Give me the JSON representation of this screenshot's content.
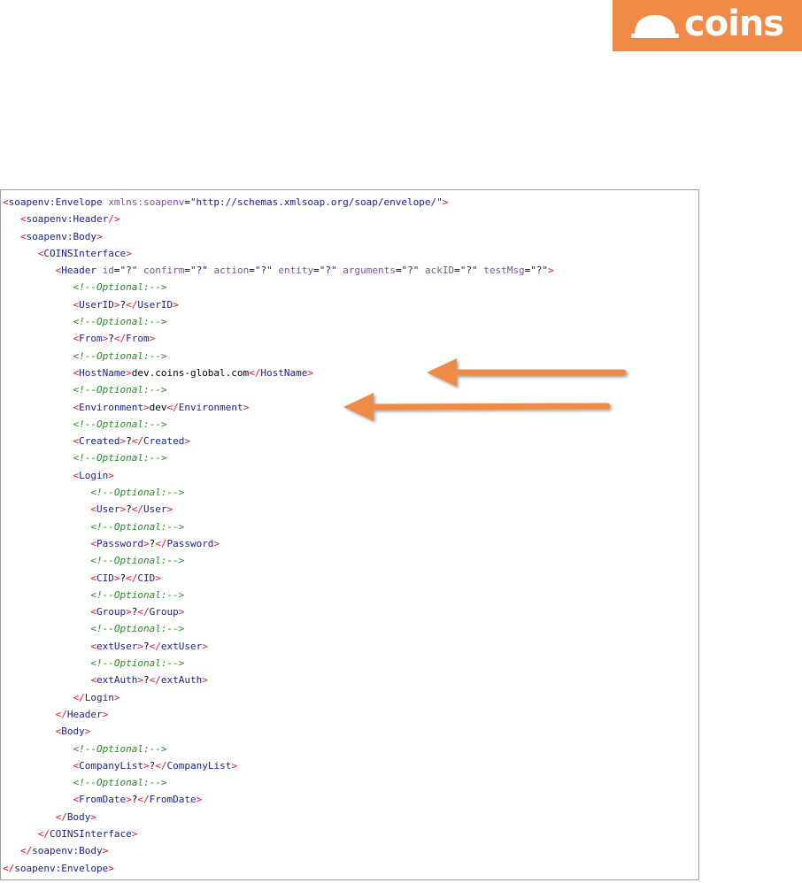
{
  "brand": {
    "logo_text": "coins",
    "logo_color": "#f08a47",
    "logo_icon": "hard-hat-icon"
  },
  "editor": {
    "highlighted_line": 13,
    "colors": {
      "bracket": "#e8162d",
      "tag": "#1a1f8c",
      "attribute": "#7c52a5",
      "value": "#1a1f8c",
      "comment": "#2a8a2a",
      "text": "#000000"
    },
    "lines": [
      {
        "indent": "",
        "tokens": [
          [
            "b",
            "<"
          ],
          [
            "n",
            "soapenv:Envelope"
          ],
          [
            "t",
            " "
          ],
          [
            "a",
            "xmlns:soapenv"
          ],
          [
            "t",
            "="
          ],
          [
            "v",
            "\"http://schemas.xmlsoap.org/soap/envelope/\""
          ],
          [
            "b",
            ">"
          ]
        ]
      },
      {
        "indent": "   ",
        "tokens": [
          [
            "b",
            "<"
          ],
          [
            "n",
            "soapenv:Header"
          ],
          [
            "b",
            "/>"
          ]
        ]
      },
      {
        "indent": "   ",
        "tokens": [
          [
            "b",
            "<"
          ],
          [
            "n",
            "soapenv:Body"
          ],
          [
            "b",
            ">"
          ]
        ]
      },
      {
        "indent": "      ",
        "tokens": [
          [
            "b",
            "<"
          ],
          [
            "n",
            "COINSInterface"
          ],
          [
            "b",
            ">"
          ]
        ]
      },
      {
        "indent": "         ",
        "tokens": [
          [
            "b",
            "<"
          ],
          [
            "n",
            "Header"
          ],
          [
            "t",
            " "
          ],
          [
            "a",
            "id"
          ],
          [
            "t",
            "="
          ],
          [
            "v",
            "\"?\""
          ],
          [
            "t",
            " "
          ],
          [
            "a",
            "confirm"
          ],
          [
            "t",
            "="
          ],
          [
            "v",
            "\"?\""
          ],
          [
            "t",
            " "
          ],
          [
            "a",
            "action"
          ],
          [
            "t",
            "="
          ],
          [
            "v",
            "\"?\""
          ],
          [
            "t",
            " "
          ],
          [
            "a",
            "entity"
          ],
          [
            "t",
            "="
          ],
          [
            "v",
            "\"?\""
          ],
          [
            "t",
            " "
          ],
          [
            "a",
            "arguments"
          ],
          [
            "t",
            "="
          ],
          [
            "v",
            "\"?\""
          ],
          [
            "t",
            " "
          ],
          [
            "a",
            "ackID"
          ],
          [
            "t",
            "="
          ],
          [
            "v",
            "\"?\""
          ],
          [
            "t",
            " "
          ],
          [
            "a",
            "testMsg"
          ],
          [
            "t",
            "="
          ],
          [
            "v",
            "\"?\""
          ],
          [
            "b",
            ">"
          ]
        ]
      },
      {
        "indent": "            ",
        "tokens": [
          [
            "c",
            "<!--Optional:-->"
          ]
        ]
      },
      {
        "indent": "            ",
        "tokens": [
          [
            "b",
            "<"
          ],
          [
            "n",
            "UserID"
          ],
          [
            "b",
            ">"
          ],
          [
            "t",
            "?"
          ],
          [
            "b",
            "</"
          ],
          [
            "n",
            "UserID"
          ],
          [
            "b",
            ">"
          ]
        ]
      },
      {
        "indent": "            ",
        "tokens": [
          [
            "c",
            "<!--Optional:-->"
          ]
        ]
      },
      {
        "indent": "            ",
        "tokens": [
          [
            "b",
            "<"
          ],
          [
            "n",
            "From"
          ],
          [
            "b",
            ">"
          ],
          [
            "t",
            "?"
          ],
          [
            "b",
            "</"
          ],
          [
            "n",
            "From"
          ],
          [
            "b",
            ">"
          ]
        ]
      },
      {
        "indent": "            ",
        "tokens": [
          [
            "c",
            "<!--Optional:-->"
          ]
        ]
      },
      {
        "indent": "            ",
        "tokens": [
          [
            "b",
            "<"
          ],
          [
            "n",
            "HostName"
          ],
          [
            "b",
            ">"
          ],
          [
            "t",
            "dev.coins-global.com"
          ],
          [
            "b",
            "</"
          ],
          [
            "n",
            "HostName"
          ],
          [
            "b",
            ">"
          ]
        ]
      },
      {
        "indent": "            ",
        "tokens": [
          [
            "c",
            "<!--Optional:-->"
          ]
        ]
      },
      {
        "indent": "            ",
        "tokens": [
          [
            "b",
            "<"
          ],
          [
            "n",
            "Environment"
          ],
          [
            "b",
            ">"
          ],
          [
            "t",
            "dev"
          ],
          [
            "b",
            "</"
          ],
          [
            "n",
            "Environment"
          ],
          [
            "b",
            ">"
          ]
        ]
      },
      {
        "indent": "            ",
        "tokens": [
          [
            "c",
            "<!--Optional:-->"
          ]
        ]
      },
      {
        "indent": "            ",
        "tokens": [
          [
            "b",
            "<"
          ],
          [
            "n",
            "Created"
          ],
          [
            "b",
            ">"
          ],
          [
            "t",
            "?"
          ],
          [
            "b",
            "</"
          ],
          [
            "n",
            "Created"
          ],
          [
            "b",
            ">"
          ]
        ]
      },
      {
        "indent": "            ",
        "tokens": [
          [
            "c",
            "<!--Optional:-->"
          ]
        ]
      },
      {
        "indent": "            ",
        "tokens": [
          [
            "b",
            "<"
          ],
          [
            "n",
            "Login"
          ],
          [
            "b",
            ">"
          ]
        ]
      },
      {
        "indent": "               ",
        "tokens": [
          [
            "c",
            "<!--Optional:-->"
          ]
        ]
      },
      {
        "indent": "               ",
        "tokens": [
          [
            "b",
            "<"
          ],
          [
            "n",
            "User"
          ],
          [
            "b",
            ">"
          ],
          [
            "t",
            "?"
          ],
          [
            "b",
            "</"
          ],
          [
            "n",
            "User"
          ],
          [
            "b",
            ">"
          ]
        ]
      },
      {
        "indent": "               ",
        "tokens": [
          [
            "c",
            "<!--Optional:-->"
          ]
        ]
      },
      {
        "indent": "               ",
        "tokens": [
          [
            "b",
            "<"
          ],
          [
            "n",
            "Password"
          ],
          [
            "b",
            ">"
          ],
          [
            "t",
            "?"
          ],
          [
            "b",
            "</"
          ],
          [
            "n",
            "Password"
          ],
          [
            "b",
            ">"
          ]
        ]
      },
      {
        "indent": "               ",
        "tokens": [
          [
            "c",
            "<!--Optional:-->"
          ]
        ]
      },
      {
        "indent": "               ",
        "tokens": [
          [
            "b",
            "<"
          ],
          [
            "n",
            "CID"
          ],
          [
            "b",
            ">"
          ],
          [
            "t",
            "?"
          ],
          [
            "b",
            "</"
          ],
          [
            "n",
            "CID"
          ],
          [
            "b",
            ">"
          ]
        ]
      },
      {
        "indent": "               ",
        "tokens": [
          [
            "c",
            "<!--Optional:-->"
          ]
        ]
      },
      {
        "indent": "               ",
        "tokens": [
          [
            "b",
            "<"
          ],
          [
            "n",
            "Group"
          ],
          [
            "b",
            ">"
          ],
          [
            "t",
            "?"
          ],
          [
            "b",
            "</"
          ],
          [
            "n",
            "Group"
          ],
          [
            "b",
            ">"
          ]
        ]
      },
      {
        "indent": "               ",
        "tokens": [
          [
            "c",
            "<!--Optional:-->"
          ]
        ]
      },
      {
        "indent": "               ",
        "tokens": [
          [
            "b",
            "<"
          ],
          [
            "n",
            "extUser"
          ],
          [
            "b",
            ">"
          ],
          [
            "t",
            "?"
          ],
          [
            "b",
            "</"
          ],
          [
            "n",
            "extUser"
          ],
          [
            "b",
            ">"
          ]
        ]
      },
      {
        "indent": "               ",
        "tokens": [
          [
            "c",
            "<!--Optional:-->"
          ]
        ]
      },
      {
        "indent": "               ",
        "tokens": [
          [
            "b",
            "<"
          ],
          [
            "n",
            "extAuth"
          ],
          [
            "b",
            ">"
          ],
          [
            "t",
            "?"
          ],
          [
            "b",
            "</"
          ],
          [
            "n",
            "extAuth"
          ],
          [
            "b",
            ">"
          ]
        ]
      },
      {
        "indent": "            ",
        "tokens": [
          [
            "b",
            "</"
          ],
          [
            "n",
            "Login"
          ],
          [
            "b",
            ">"
          ]
        ]
      },
      {
        "indent": "         ",
        "tokens": [
          [
            "b",
            "</"
          ],
          [
            "n",
            "Header"
          ],
          [
            "b",
            ">"
          ]
        ]
      },
      {
        "indent": "         ",
        "tokens": [
          [
            "b",
            "<"
          ],
          [
            "n",
            "Body"
          ],
          [
            "b",
            ">"
          ]
        ]
      },
      {
        "indent": "            ",
        "tokens": [
          [
            "c",
            "<!--Optional:-->"
          ]
        ]
      },
      {
        "indent": "            ",
        "tokens": [
          [
            "b",
            "<"
          ],
          [
            "n",
            "CompanyList"
          ],
          [
            "b",
            ">"
          ],
          [
            "t",
            "?"
          ],
          [
            "b",
            "</"
          ],
          [
            "n",
            "CompanyList"
          ],
          [
            "b",
            ">"
          ]
        ]
      },
      {
        "indent": "            ",
        "tokens": [
          [
            "c",
            "<!--Optional:-->"
          ]
        ]
      },
      {
        "indent": "            ",
        "tokens": [
          [
            "b",
            "<"
          ],
          [
            "n",
            "FromDate"
          ],
          [
            "b",
            ">"
          ],
          [
            "t",
            "?"
          ],
          [
            "b",
            "</"
          ],
          [
            "n",
            "FromDate"
          ],
          [
            "b",
            ">"
          ]
        ]
      },
      {
        "indent": "         ",
        "tokens": [
          [
            "b",
            "</"
          ],
          [
            "n",
            "Body"
          ],
          [
            "b",
            ">"
          ]
        ]
      },
      {
        "indent": "      ",
        "tokens": [
          [
            "b",
            "</"
          ],
          [
            "n",
            "COINSInterface"
          ],
          [
            "b",
            ">"
          ]
        ]
      },
      {
        "indent": "   ",
        "tokens": [
          [
            "b",
            "</"
          ],
          [
            "n",
            "soapenv:Body"
          ],
          [
            "b",
            ">"
          ]
        ]
      },
      {
        "indent": "",
        "tokens": [
          [
            "b",
            "</"
          ],
          [
            "n",
            "soapenv:Envelope"
          ],
          [
            "b",
            ">"
          ]
        ]
      }
    ]
  },
  "annotations": {
    "arrow_color": "#f08a47",
    "arrows": [
      {
        "points_to_line": 10
      },
      {
        "points_to_line": 12
      }
    ]
  }
}
